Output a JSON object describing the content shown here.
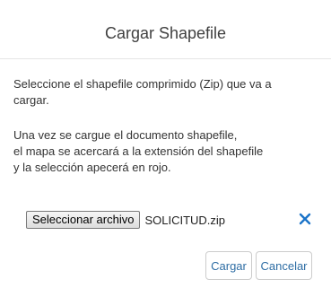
{
  "dialog": {
    "title": "Cargar Shapefile",
    "paragraph1": "Seleccione el shapefile comprimido (Zip) que va a\ncargar.",
    "paragraph2": "Una vez se cargue el documento shapefile,\nel mapa se acercará a la extensión del shapefile\ny la selección apecerá en rojo."
  },
  "file_input": {
    "button_label": "Seleccionar archivo",
    "file_name": "SOLICITUD.zip"
  },
  "clear_icon": "close-icon",
  "footer": {
    "submit_label": "Cargar",
    "cancel_label": "Cancelar"
  },
  "colors": {
    "accent": "#2e6da4",
    "clear_icon": "#1a73c8"
  }
}
